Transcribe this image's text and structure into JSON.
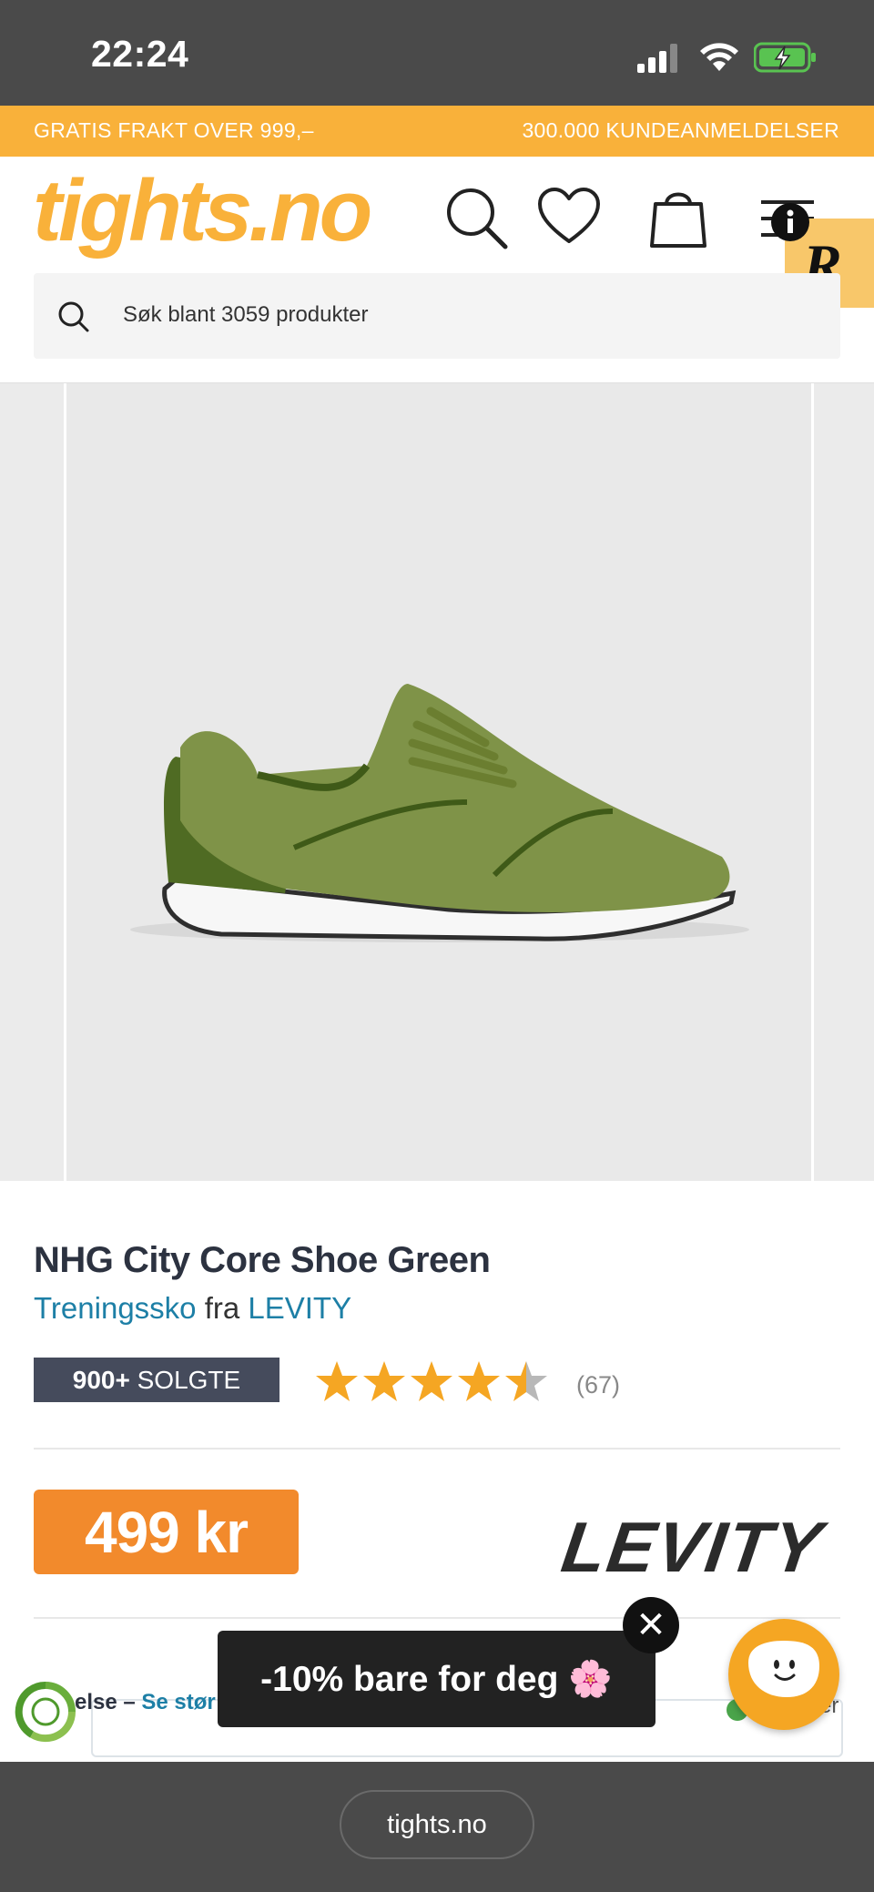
{
  "status_bar": {
    "time": "22:24"
  },
  "promo_bar": {
    "left_text": "GRATIS FRAKT OVER 999,–",
    "right_text": "300.000 KUNDEANMELDELSER"
  },
  "header": {
    "logo_text": "tights.no",
    "search_placeholder": "Søk blant 3059 produkter"
  },
  "product": {
    "title": "NHG City Core Shoe Green",
    "category": "Treningssko",
    "from_word": "fra",
    "brand": "LEVITY",
    "sold_count": "900+",
    "sold_label": "SOLGTE",
    "rating": 4.5,
    "rating_max": 5,
    "review_count": "(67)",
    "price": "499 kr",
    "brand_logo_text": "LEVITY"
  },
  "size_row": {
    "text": "else – ",
    "link": "Se stør",
    "partial_right": "er"
  },
  "popup": {
    "text": "-10% bare for deg 🌸",
    "close_label": "✕"
  },
  "browser": {
    "url": "tights.no"
  },
  "colors": {
    "accent_yellow": "#f9b13a",
    "price_orange": "#f28a2c",
    "link_blue": "#1d7fa6",
    "badge_dark": "#454b5c",
    "star": "#f5a623"
  },
  "icons": [
    "signal-icon",
    "wifi-icon",
    "battery-charging-icon",
    "search-icon",
    "heart-icon",
    "shopping-bag-icon",
    "menu-icon",
    "info-icon",
    "reward-r-icon",
    "eco-icon",
    "chat-face-icon",
    "close-icon",
    "star-icon"
  ]
}
